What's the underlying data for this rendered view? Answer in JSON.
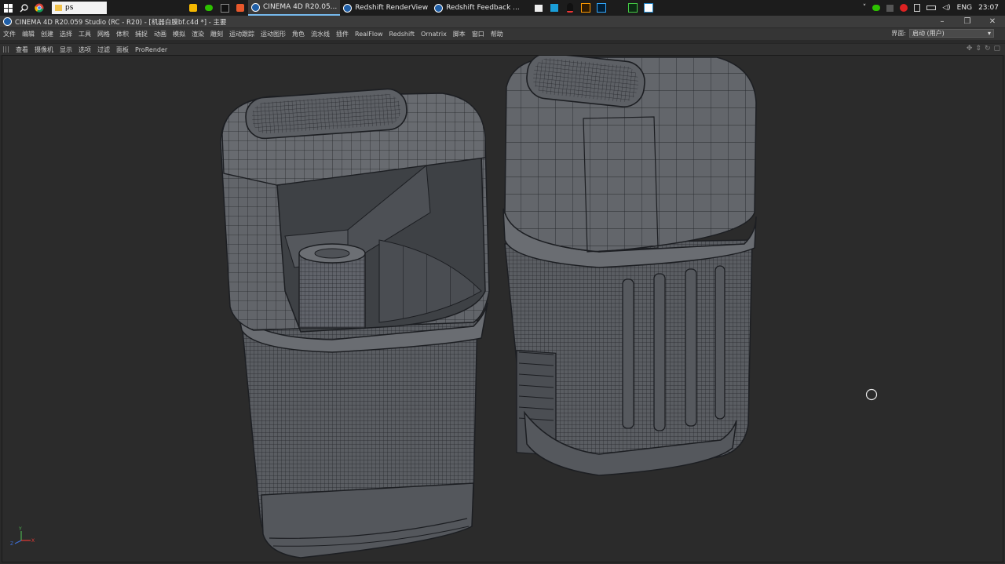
{
  "taskbar": {
    "search_text": "ps",
    "apps": [
      {
        "label": "CINEMA 4D R20.05...",
        "active": true
      },
      {
        "label": "Redshift RenderView",
        "active": false
      },
      {
        "label": "Redshift Feedback ...",
        "active": false
      }
    ],
    "tray": {
      "language": "ENG",
      "time": "23:07"
    }
  },
  "titlebar": {
    "title": "CINEMA 4D R20.059 Studio (RC - R20) - [机器白膜bf.c4d *] - 主要"
  },
  "menubar": {
    "items": [
      "文件",
      "编辑",
      "创建",
      "选择",
      "工具",
      "网格",
      "体积",
      "捕捉",
      "动画",
      "模拟",
      "渲染",
      "雕刻",
      "运动跟踪",
      "运动图形",
      "角色",
      "流水线",
      "插件",
      "RealFlow",
      "Redshift",
      "Ornatrix",
      "脚本",
      "窗口",
      "帮助"
    ],
    "layout_label": "界面:",
    "layout_value": "启动 (用户)"
  },
  "viewport_menu": {
    "items": [
      "查看",
      "摄像机",
      "显示",
      "选项",
      "过滤",
      "面板",
      "ProRender"
    ]
  },
  "axis": {
    "x": "X",
    "y": "Y",
    "z": "Z"
  },
  "colors": {
    "accent": "#76b9ed",
    "mesh_fill": "#5e6166",
    "wire": "#1e2024",
    "bg": "#2b2b2b"
  }
}
